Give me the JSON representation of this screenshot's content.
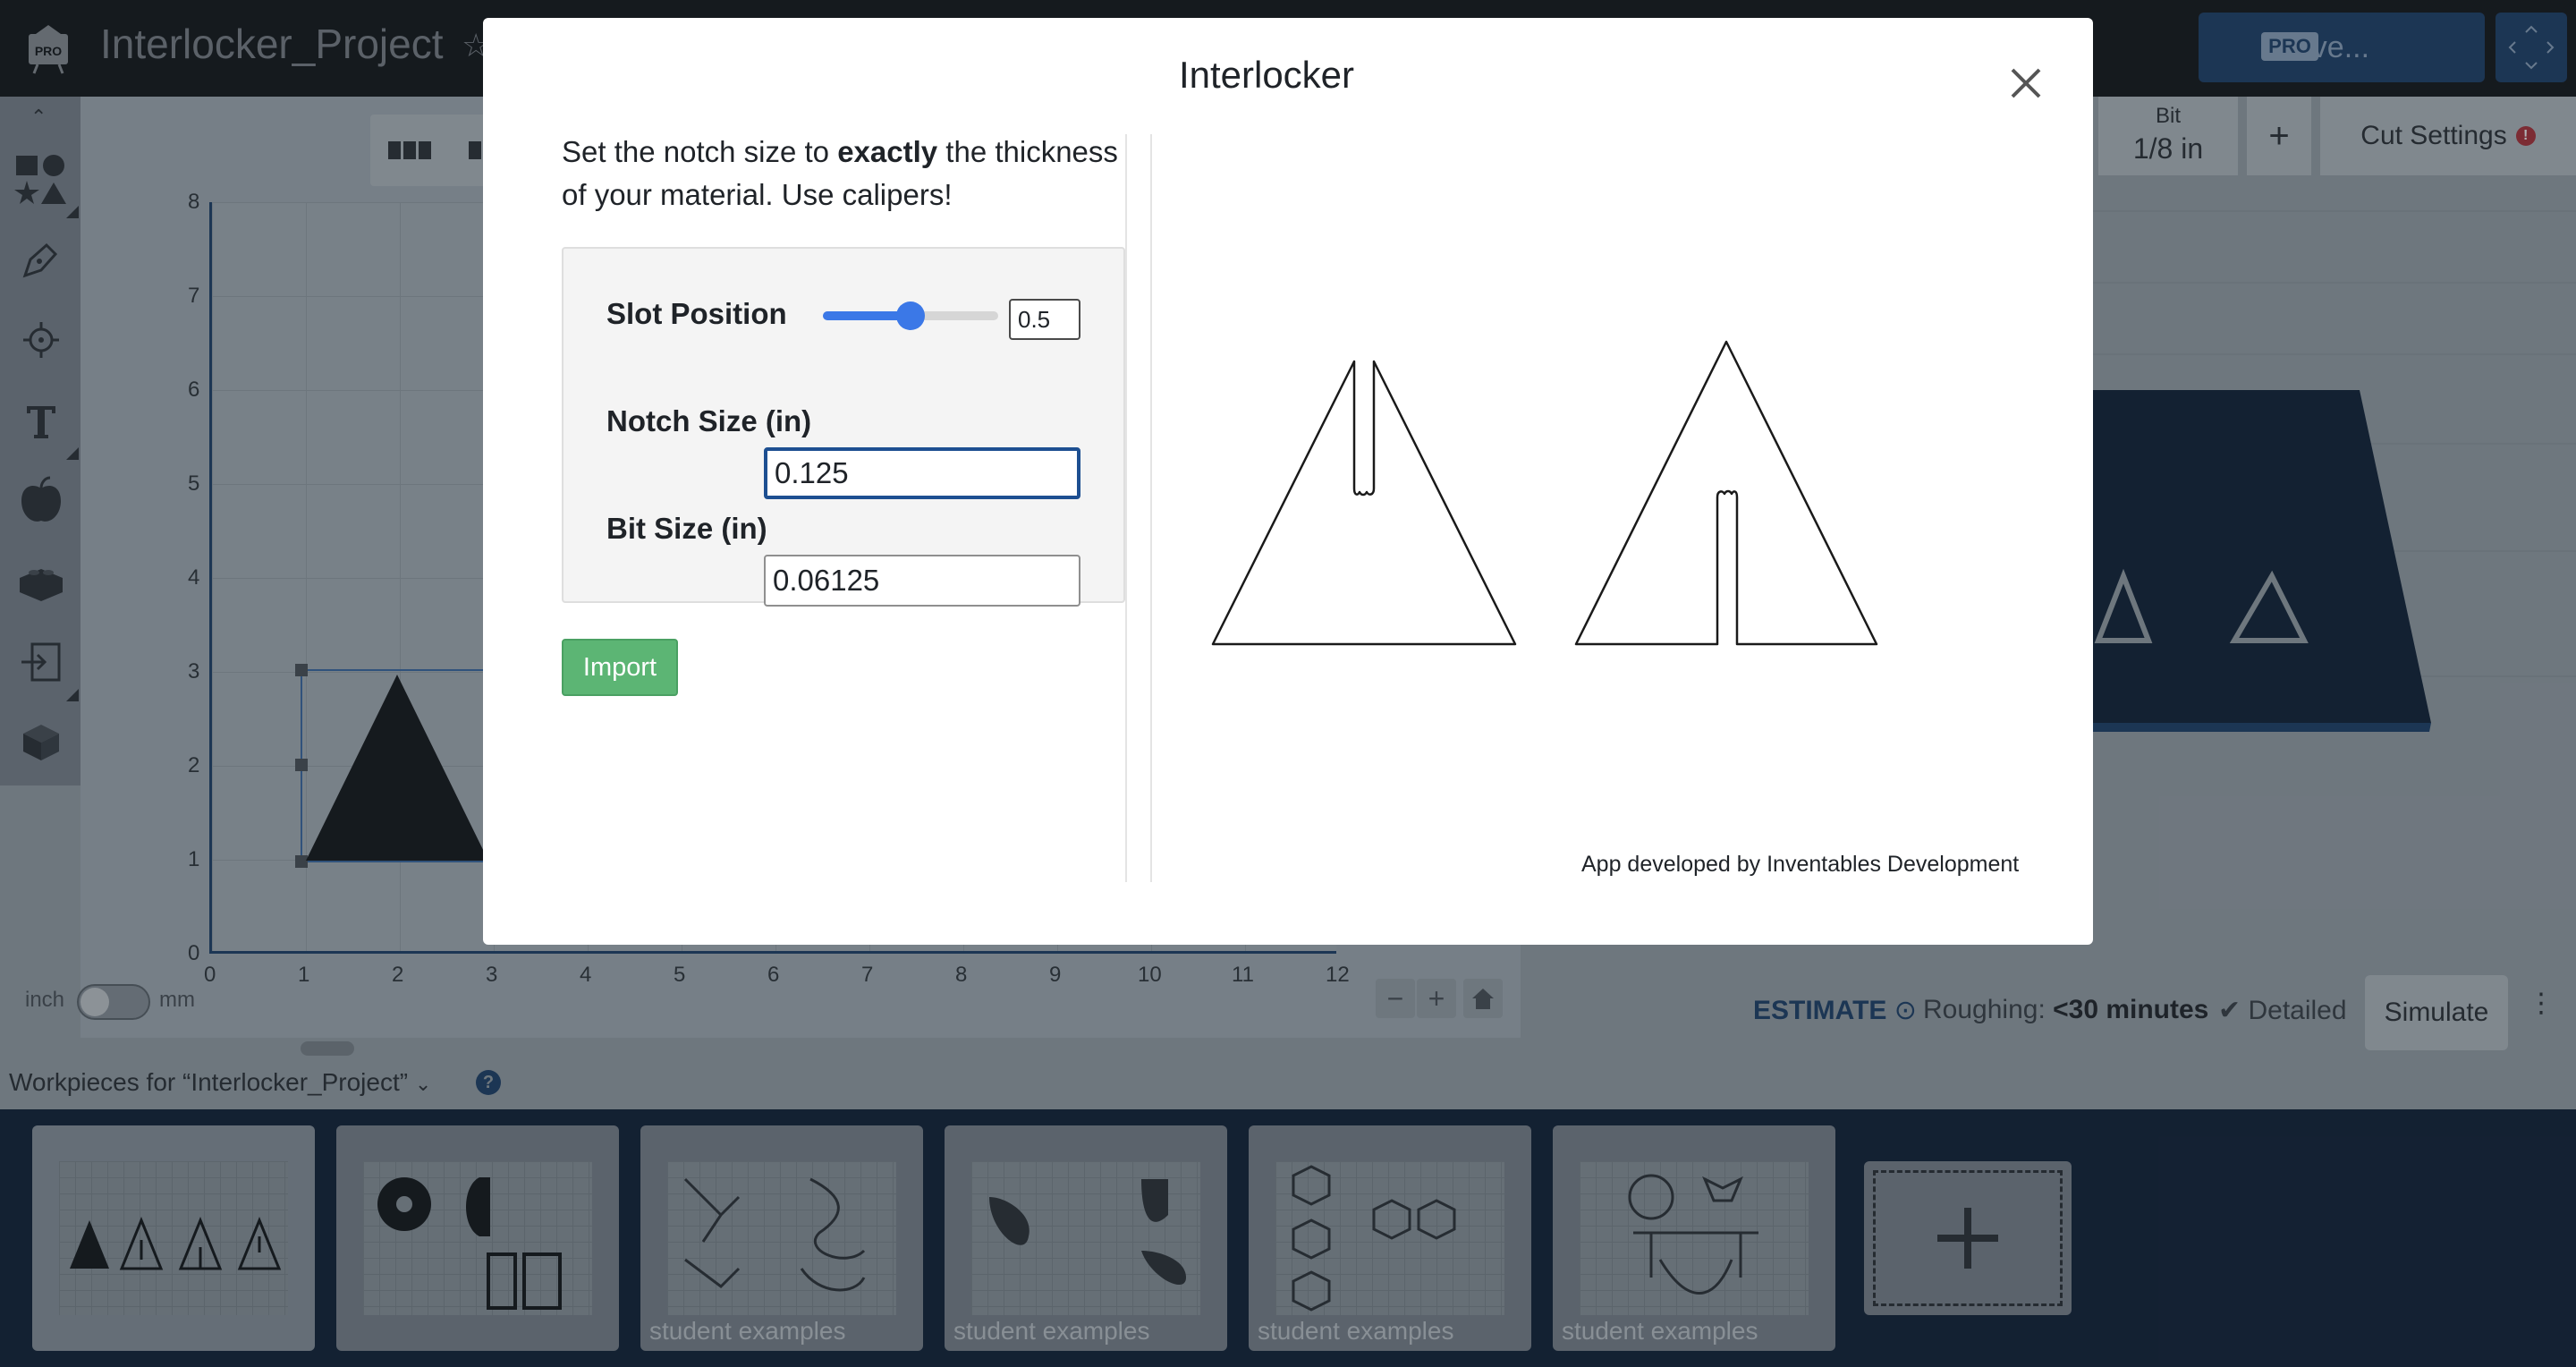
{
  "app": {
    "project_title": "Interlocker_Project",
    "carve_label": "Carve...",
    "pro_badge": "PRO"
  },
  "canvas": {
    "y_ticks": [
      "8",
      "7",
      "6",
      "5",
      "4",
      "3",
      "2",
      "1",
      "0"
    ],
    "x_ticks": [
      "0",
      "1",
      "2",
      "3",
      "4",
      "5",
      "6",
      "7",
      "8",
      "9",
      "10",
      "11",
      "12"
    ],
    "unit_inch": "inch",
    "unit_mm": "mm"
  },
  "right_panel": {
    "bit_label": "Bit",
    "bit_value": "1/8 in",
    "cut_settings_label": "Cut Settings",
    "alert_glyph": "!",
    "estimate_label": "ESTIMATE",
    "roughing_label": "Roughing:",
    "roughing_value": "<30 minutes",
    "detailed_label": "Detailed",
    "simulate_label": "Simulate"
  },
  "workpieces": {
    "title": "Workpieces for “Interlocker_Project”",
    "help_glyph": "?",
    "cards": [
      {
        "label": ""
      },
      {
        "label": ""
      },
      {
        "label": "student examples"
      },
      {
        "label": "student examples"
      },
      {
        "label": "student examples"
      },
      {
        "label": "student examples"
      }
    ]
  },
  "modal": {
    "title": "Interlocker",
    "instruction_pre": "Set the notch size to ",
    "instruction_bold": "exactly",
    "instruction_post": " the thickness of your material. Use calipers!",
    "slot_position_label": "Slot Position",
    "slot_position_value": "0.5",
    "slot_position_fraction": 0.5,
    "notch_size_label": "Notch Size (in)",
    "notch_size_value": "0.125",
    "bit_size_label": "Bit Size (in)",
    "bit_size_value": "0.06125",
    "import_label": "Import",
    "credit": "App developed by Inventables Development"
  },
  "colors": {
    "brand_navy": "#1d3f6a",
    "import_green": "#5cb574",
    "slider_blue": "#3b78e7",
    "alert_red": "#b0303a"
  },
  "icons": [
    "pro-logo-icon",
    "star-icon",
    "fullscreen-icon",
    "collapse-icon",
    "shapes-icon",
    "pen-icon",
    "target-icon",
    "text-icon",
    "apple-icon",
    "lego-icon",
    "import-icon",
    "cube-icon",
    "close-icon",
    "help-icon",
    "clock-icon",
    "check-icon",
    "kebab-icon",
    "plus-icon",
    "home-icon",
    "minus-icon"
  ]
}
